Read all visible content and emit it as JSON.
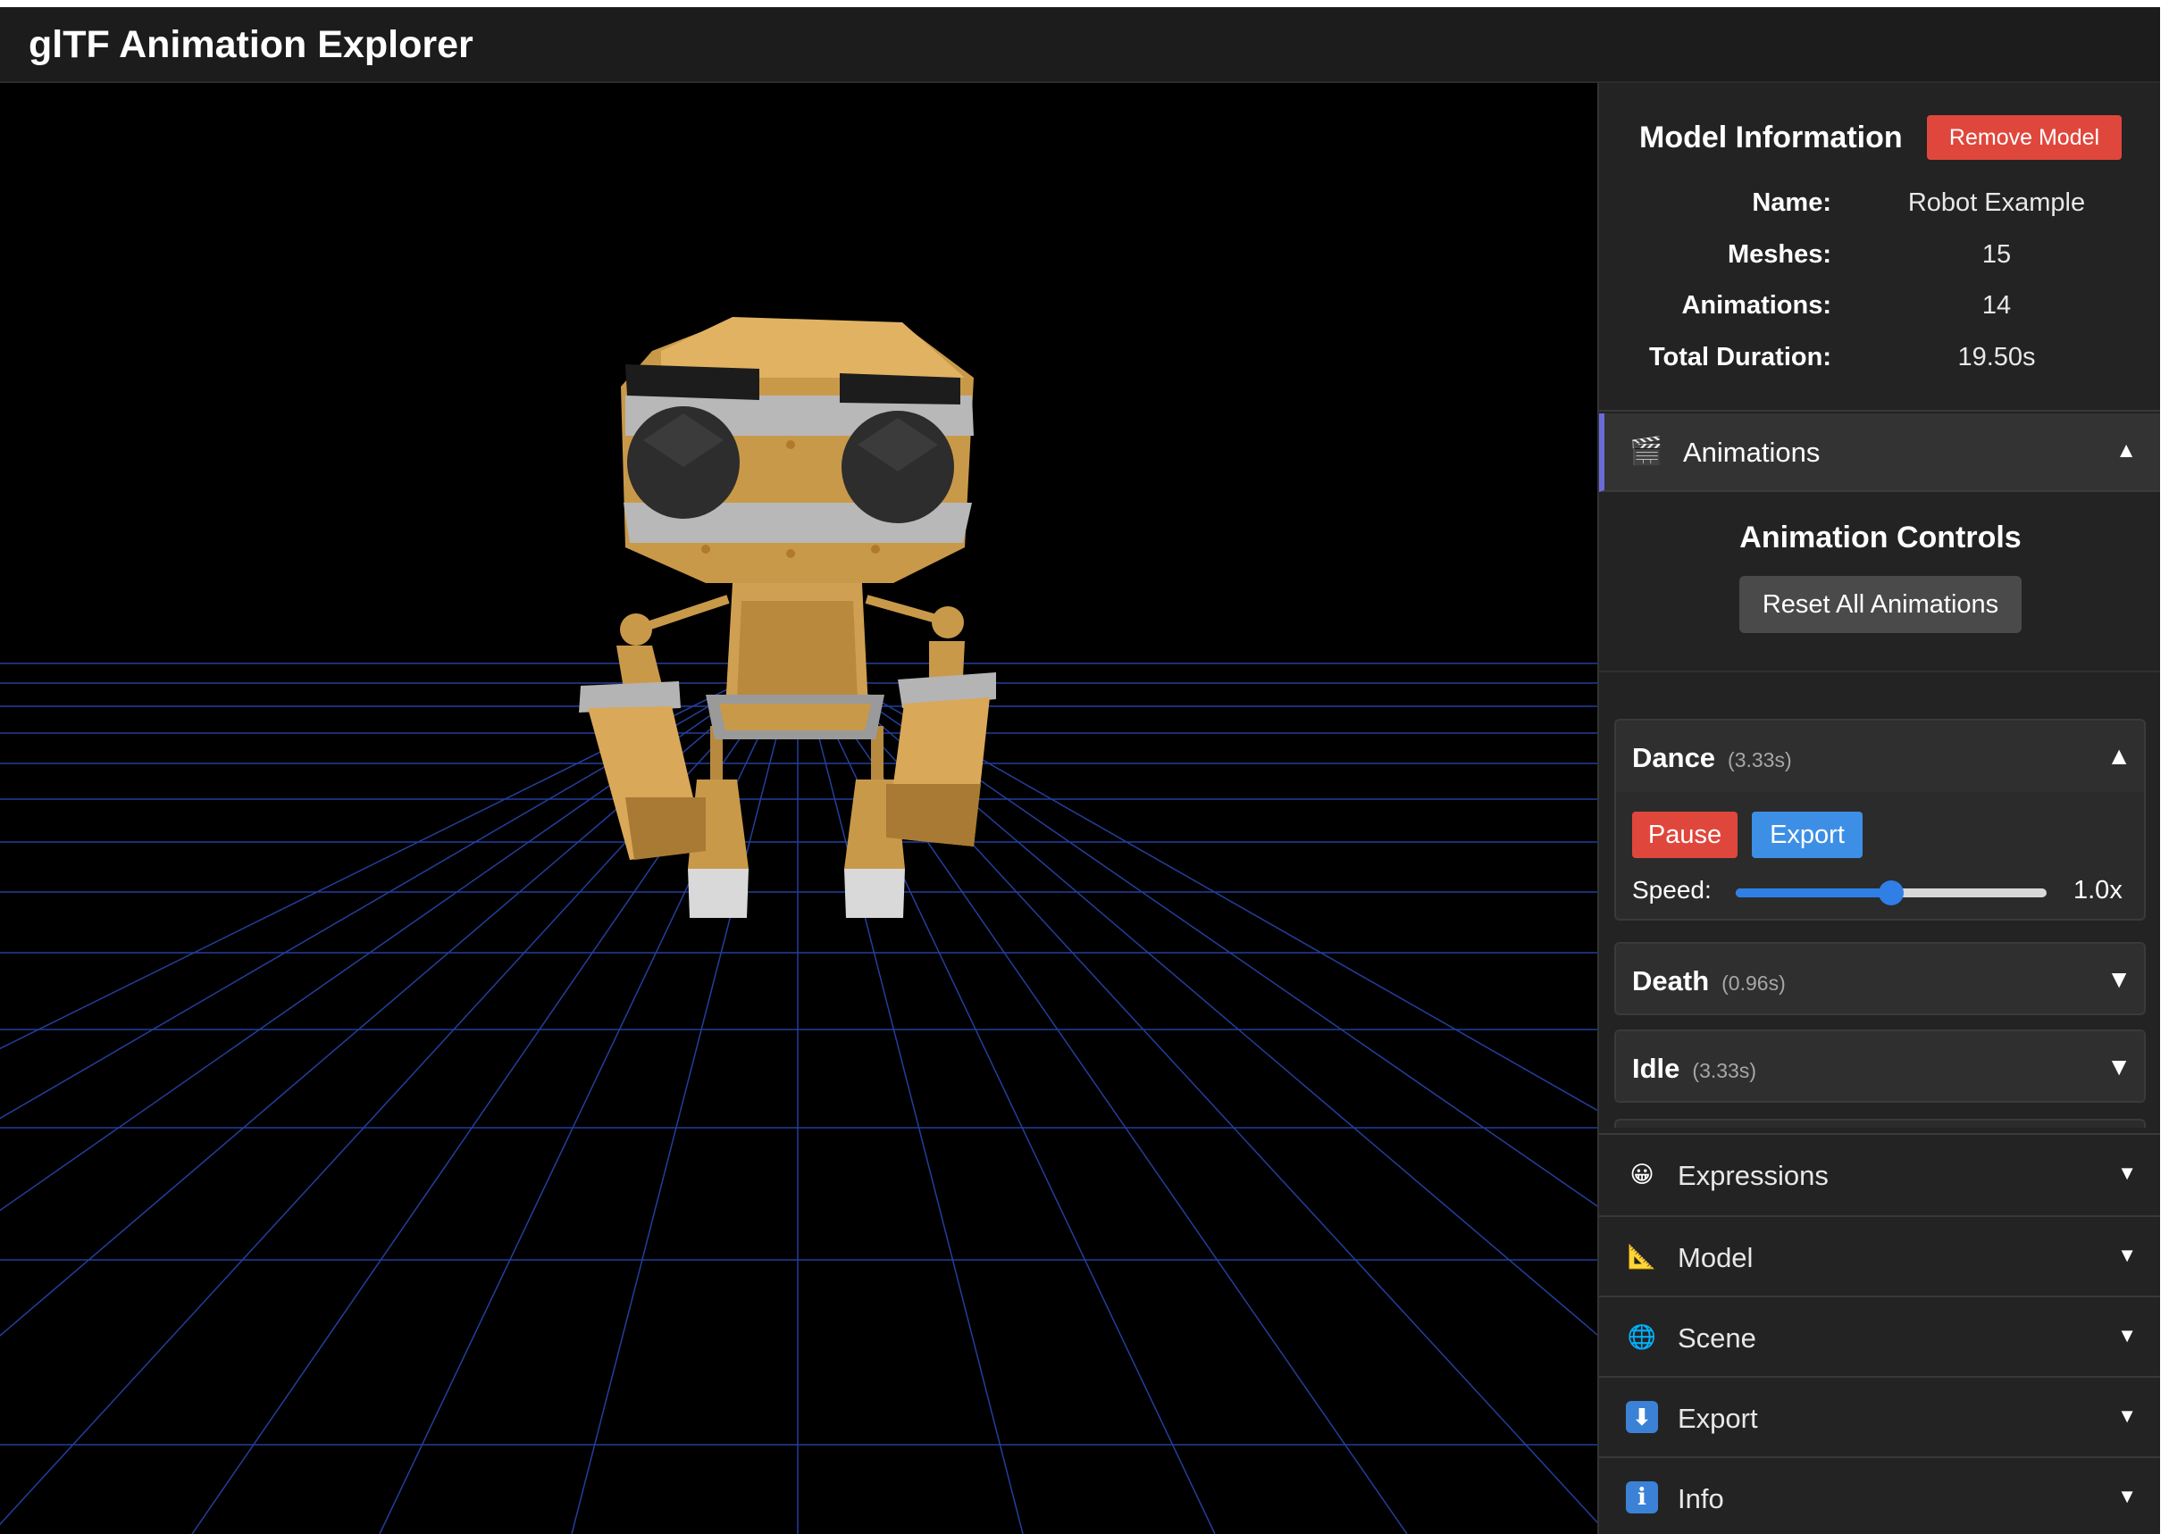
{
  "app": {
    "title": "glTF Animation Explorer"
  },
  "model_info": {
    "heading": "Model Information",
    "remove_label": "Remove Model",
    "rows": [
      {
        "label": "Name:",
        "value": "Robot Example"
      },
      {
        "label": "Meshes:",
        "value": "15"
      },
      {
        "label": "Animations:",
        "value": "14"
      },
      {
        "label": "Total Duration:",
        "value": "19.50s"
      }
    ]
  },
  "animations_section": {
    "label": "Animations",
    "icon": "clapperboard-icon",
    "icon_glyph": "🎬",
    "chevron": "▲",
    "controls_title": "Animation Controls",
    "reset_label": "Reset All Animations",
    "items": [
      {
        "name": "Dance",
        "duration": "(3.33s)",
        "chevron": "▲",
        "expanded": true,
        "pause_label": "Pause",
        "export_label": "Export",
        "speed_label": "Speed:",
        "speed_value": "1.0x",
        "speed_fraction": 0.5
      },
      {
        "name": "Death",
        "duration": "(0.96s)",
        "chevron": "▼",
        "expanded": false
      },
      {
        "name": "Idle",
        "duration": "(3.33s)",
        "chevron": "▼",
        "expanded": false
      }
    ]
  },
  "sections": [
    {
      "label": "Expressions",
      "icon": "smiley-icon",
      "glyph": "😀",
      "chevron": "▼"
    },
    {
      "label": "Model",
      "icon": "triangle-ruler-icon",
      "glyph": "📐",
      "chevron": "▼"
    },
    {
      "label": "Scene",
      "icon": "globe-icon",
      "glyph": "🌐",
      "chevron": "▼"
    },
    {
      "label": "Export",
      "icon": "download-icon",
      "glyph": "⬇",
      "chevron": "▼"
    },
    {
      "label": "Info",
      "icon": "info-icon",
      "glyph": "i",
      "chevron": "▼"
    }
  ],
  "colors": {
    "accent_red": "#e0473c",
    "accent_blue": "#3d8fe6",
    "grid_line": "#2a4ab8",
    "robot_body": "#c9994a"
  }
}
